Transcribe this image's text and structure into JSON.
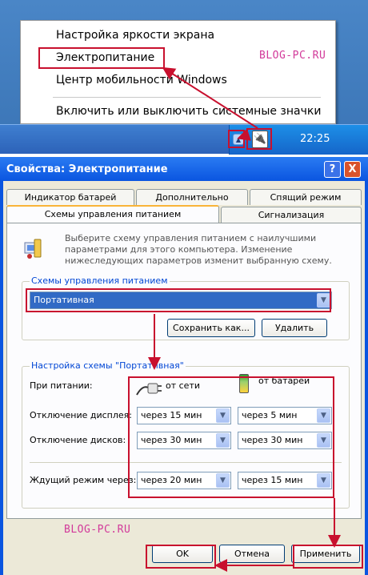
{
  "context_menu": {
    "items": [
      "Настройка яркости экрана",
      "Электропитание",
      "Центр мобильности Windows",
      "Включить или выключить системные значки"
    ]
  },
  "watermarks": [
    "BLOG-PC.RU",
    "BLOG-PC.RU"
  ],
  "taskbar": {
    "clock": "22:25",
    "tray_arrow_icon": "chevron-up-icon",
    "tray_power_icon": "power-plug-icon"
  },
  "dialog": {
    "title": "Свойства: Электропитание",
    "title_buttons": {
      "help": "?",
      "close": "X"
    },
    "tabs_back": [
      "Индикатор батарей",
      "Дополнительно",
      "Спящий режим"
    ],
    "tabs_front": [
      "Схемы управления питанием",
      "Сигнализация"
    ],
    "description": "Выберите схему управления питанием с наилучшими параметрами для этого компьютера. Изменение нижеследующих параметров изменит выбранную схему.",
    "schemes_group": {
      "label": "Схемы управления питанием",
      "selected": "Портативная",
      "save_as": "Сохранить как...",
      "delete": "Удалить"
    },
    "settings_group": {
      "label": "Настройка схемы \"Портативная\"",
      "power_source_label": "При питании:",
      "ac_label": "от сети",
      "battery_label": "от батарей",
      "rows": [
        {
          "label": "Отключение дисплея:",
          "ac": "через 15 мин",
          "battery": "через 5 мин"
        },
        {
          "label": "Отключение дисков:",
          "ac": "через 30 мин",
          "battery": "через 30 мин"
        },
        {
          "label": "Ждущий режим через:",
          "ac": "через 20 мин",
          "battery": "через 15 мин"
        }
      ]
    },
    "buttons": {
      "ok": "OK",
      "cancel": "Отмена",
      "apply": "Применить"
    }
  },
  "colors": {
    "highlight": "#c8102e",
    "titlebar": "#0a55e0",
    "selection": "#316ac5",
    "watermark": "#d23a9a"
  }
}
